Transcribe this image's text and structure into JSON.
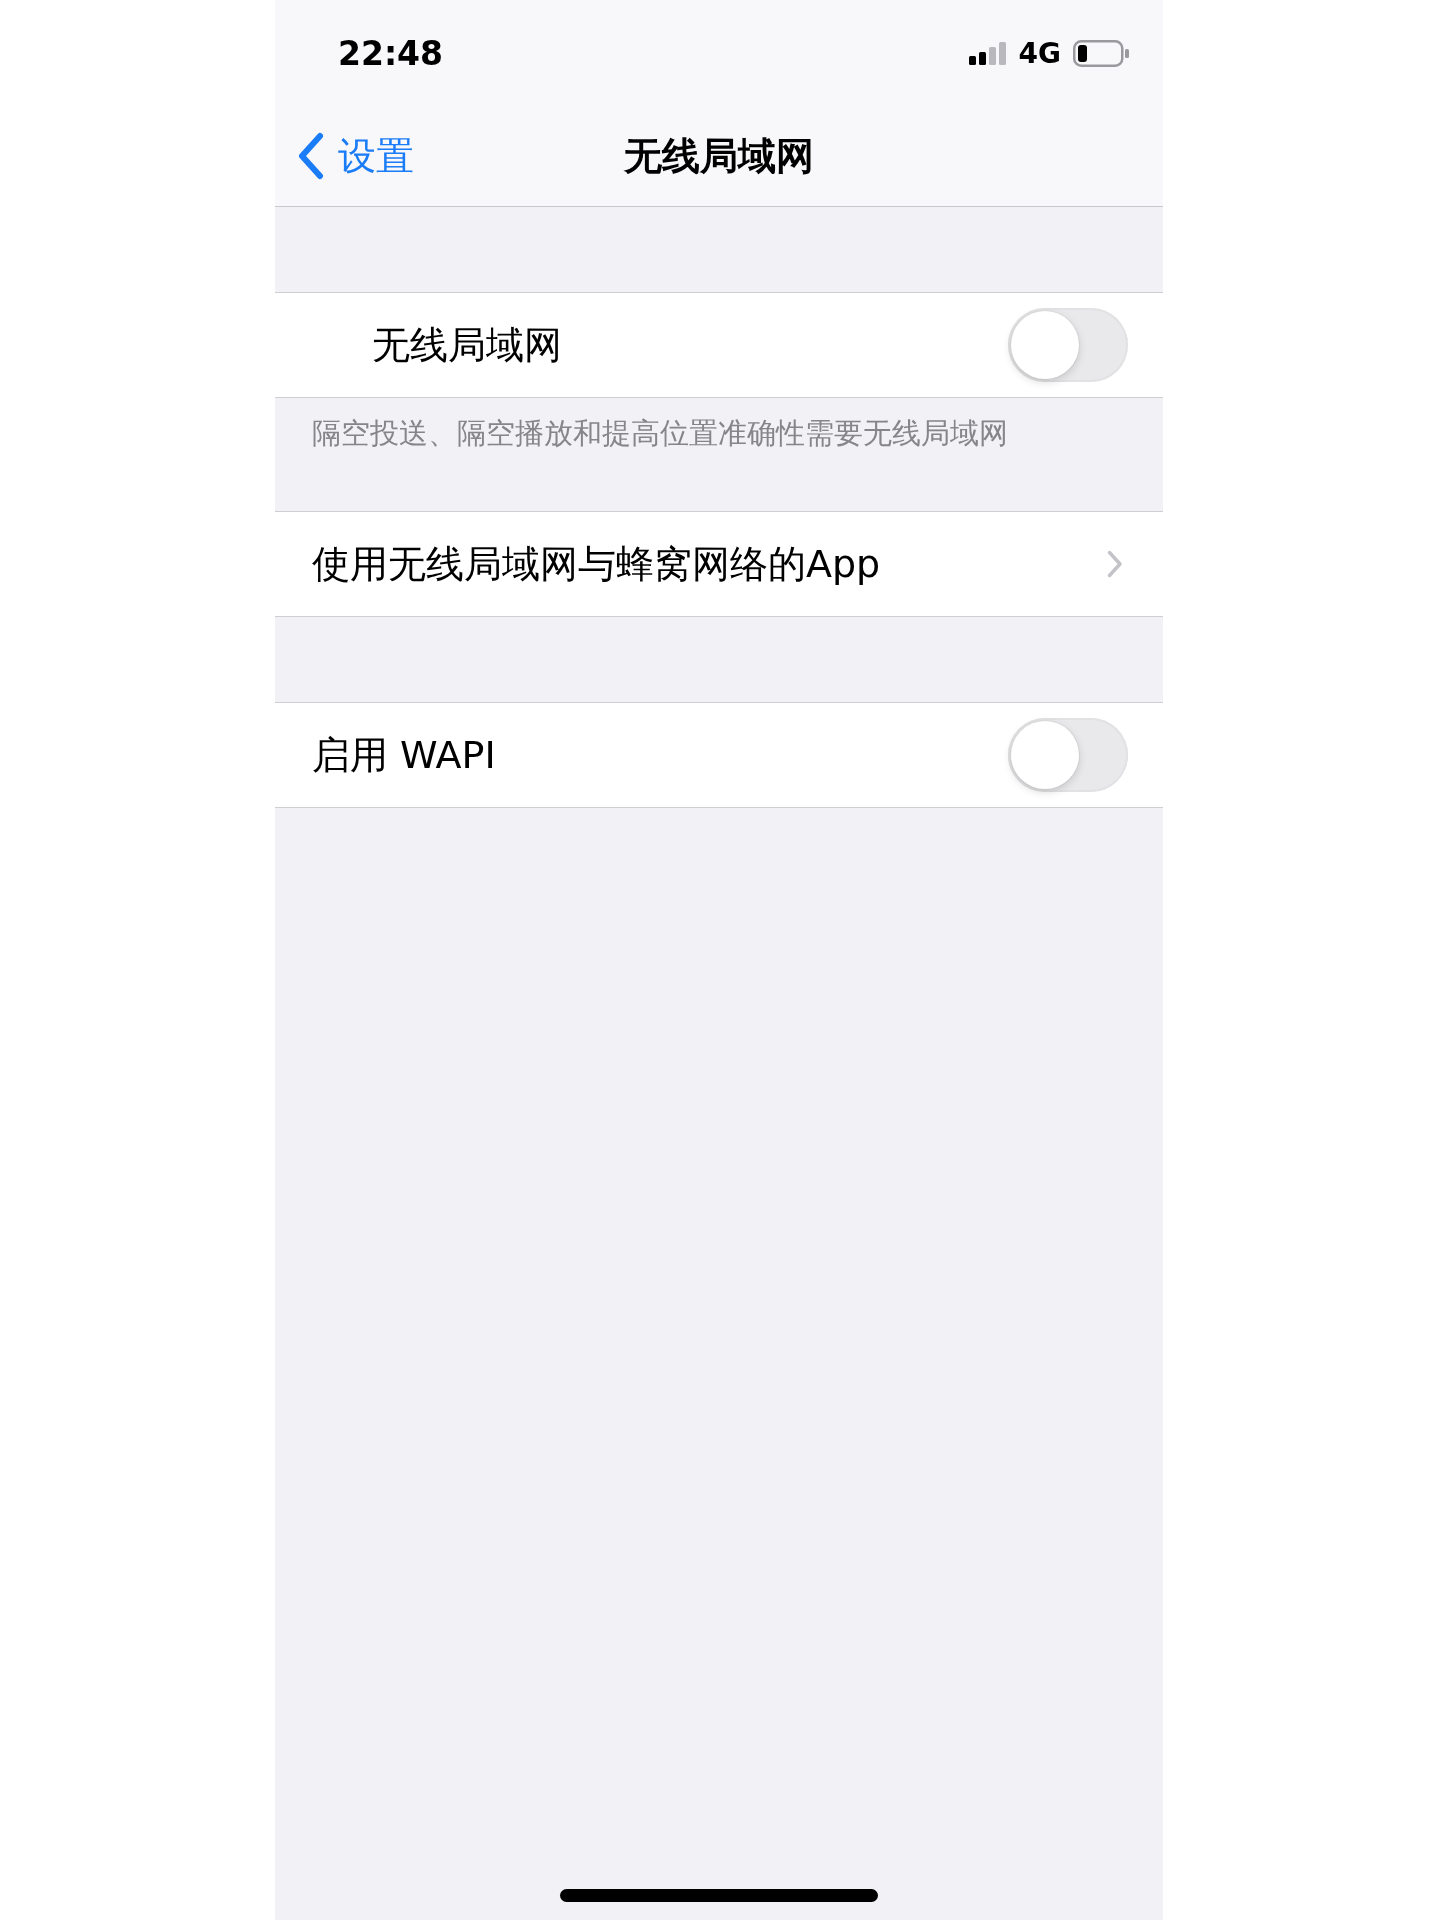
{
  "status_bar": {
    "time": "22:48",
    "network": "4G"
  },
  "nav_bar": {
    "back_label": "设置",
    "title": "无线局域网"
  },
  "sections": [
    {
      "rows": [
        {
          "kind": "toggle",
          "label": "无线局域网",
          "indented": true,
          "on": false
        }
      ],
      "footer": "隔空投送、隔空播放和提高位置准确性需要无线局域网"
    },
    {
      "rows": [
        {
          "kind": "link",
          "label": "使用无线局域网与蜂窝网络的App",
          "indented": false
        }
      ]
    },
    {
      "rows": [
        {
          "kind": "toggle",
          "label": "启用 WAPI",
          "indented": false,
          "on": false
        }
      ]
    }
  ]
}
